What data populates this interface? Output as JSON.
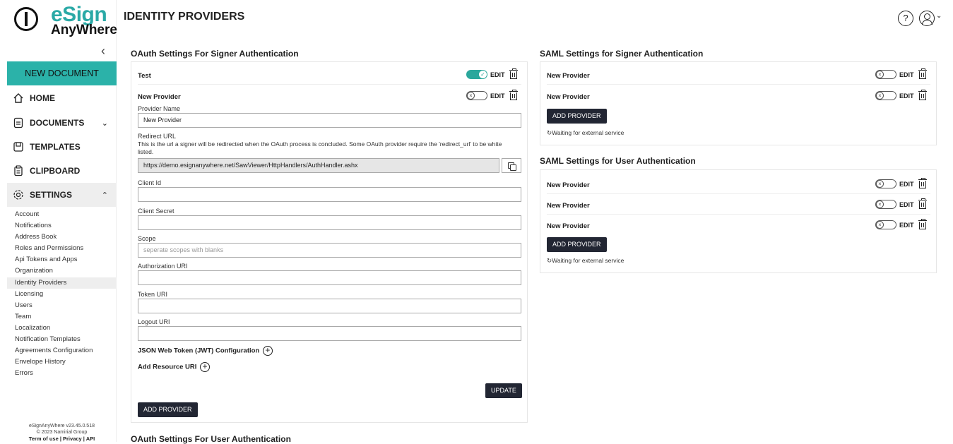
{
  "app": {
    "logo_line1": "eSign",
    "logo_line2": "AnyWhere",
    "page_title": "IDENTITY PROVIDERS",
    "help_glyph": "?",
    "user_chevron": "⌄"
  },
  "sidebar": {
    "collapse_glyph": "‹",
    "new_document": "NEW DOCUMENT",
    "nav": [
      {
        "label": "HOME",
        "icon": "home-icon"
      },
      {
        "label": "DOCUMENTS",
        "icon": "document-icon",
        "chevron": "⌄"
      },
      {
        "label": "TEMPLATES",
        "icon": "template-icon"
      },
      {
        "label": "CLIPBOARD",
        "icon": "clipboard-icon"
      },
      {
        "label": "SETTINGS",
        "icon": "gear-icon",
        "chevron": "⌃"
      }
    ],
    "settings_items": [
      "Account",
      "Notifications",
      "Address Book",
      "Roles and Permissions",
      "Api Tokens and Apps",
      "Organization",
      "Identity Providers",
      "Licensing",
      "Users",
      "Team",
      "Localization",
      "Notification Templates",
      "Agreements Configuration",
      "Envelope History",
      "Errors"
    ],
    "selected_item": "Identity Providers",
    "footer": {
      "version": "eSignAnyWhere v23.45.0.518",
      "copyright": "© 2023 Namirial Group",
      "links": "Term of use | Privacy | API"
    }
  },
  "oauth_signer": {
    "title": "OAuth Settings For Signer Authentication",
    "providers": [
      {
        "name": "Test",
        "enabled": true,
        "edit": "EDIT"
      },
      {
        "name": "New Provider",
        "enabled": false,
        "edit": "EDIT"
      }
    ],
    "form": {
      "provider_name_label": "Provider Name",
      "provider_name_value": "New Provider",
      "redirect_label": "Redirect URL",
      "redirect_help": "This is the url a signer will be redirected when the OAuth process is concluded. Some OAuth provider require the 'redirect_url' to be white listed.",
      "redirect_value": "https://demo.esignanywhere.net/SawViewer/HttpHandlers/AuthHandler.ashx",
      "client_id_label": "Client Id",
      "client_secret_label": "Client Secret",
      "scope_label": "Scope",
      "scope_placeholder": "seperate scopes with blanks",
      "auth_uri_label": "Authorization URI",
      "token_uri_label": "Token URI",
      "logout_uri_label": "Logout URI",
      "jwt_label": "JSON Web Token (JWT) Configuration",
      "resource_label": "Add Resource URI",
      "update_button": "UPDATE"
    },
    "add_provider": "ADD PROVIDER"
  },
  "oauth_user": {
    "title": "OAuth Settings For User Authentication"
  },
  "saml_signer": {
    "title": "SAML Settings for Signer Authentication",
    "providers": [
      {
        "name": "New Provider",
        "enabled": false,
        "edit": "EDIT"
      },
      {
        "name": "New Provider",
        "enabled": false,
        "edit": "EDIT"
      }
    ],
    "add_provider": "ADD PROVIDER",
    "status": "Waiting for external service"
  },
  "saml_user": {
    "title": "SAML Settings for User Authentication",
    "providers": [
      {
        "name": "New Provider",
        "enabled": false,
        "edit": "EDIT"
      },
      {
        "name": "New Provider",
        "enabled": false,
        "edit": "EDIT"
      },
      {
        "name": "New Provider",
        "enabled": false,
        "edit": "EDIT"
      }
    ],
    "add_provider": "ADD PROVIDER",
    "status": "Waiting for external service"
  },
  "glyphs": {
    "toggle_off": "×",
    "toggle_on": "✓",
    "plus": "+",
    "refresh": "↻"
  },
  "colors": {
    "accent": "#2bb2a9",
    "toggle_on": "#2ba79c",
    "button_dark": "#222633",
    "logo_teal": "#2aa9a6"
  }
}
